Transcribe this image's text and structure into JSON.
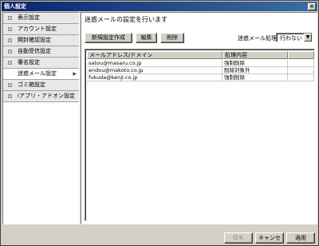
{
  "window": {
    "title": "個人設定",
    "close_label": "×"
  },
  "sidebar": {
    "items": [
      {
        "label": "表示設定"
      },
      {
        "label": "アカウント設定"
      },
      {
        "label": "開封確認設定"
      },
      {
        "label": "自動受信設定"
      },
      {
        "label": "署名設定"
      },
      {
        "label": "迷惑メール設定",
        "active": true
      },
      {
        "label": "ゴミ箱設定"
      },
      {
        "label": "iアプリ・アドオン設定"
      }
    ],
    "active_arrow": "▶"
  },
  "main": {
    "description": "迷惑メールの設定を行います",
    "toolbar": {
      "new_label": "新規設定作成",
      "edit_label": "編集",
      "delete_label": "削除"
    },
    "process": {
      "label": "迷惑メール処理",
      "value": "行わない",
      "arrow": "▼"
    },
    "table": {
      "headers": [
        "メールアドレス/ドメイン",
        "処理内容"
      ],
      "rows": [
        {
          "address": "satou@masaru.co.jp",
          "action": "強制削除"
        },
        {
          "address": "endou@makoto.co.jp",
          "action": "削除対象外"
        },
        {
          "address": "fukuda@kenji.co.jp",
          "action": "強制削除"
        }
      ]
    }
  },
  "footer": {
    "ok_label": "ＯＫ",
    "cancel_label": "キャンセル",
    "apply_label": "適用"
  }
}
